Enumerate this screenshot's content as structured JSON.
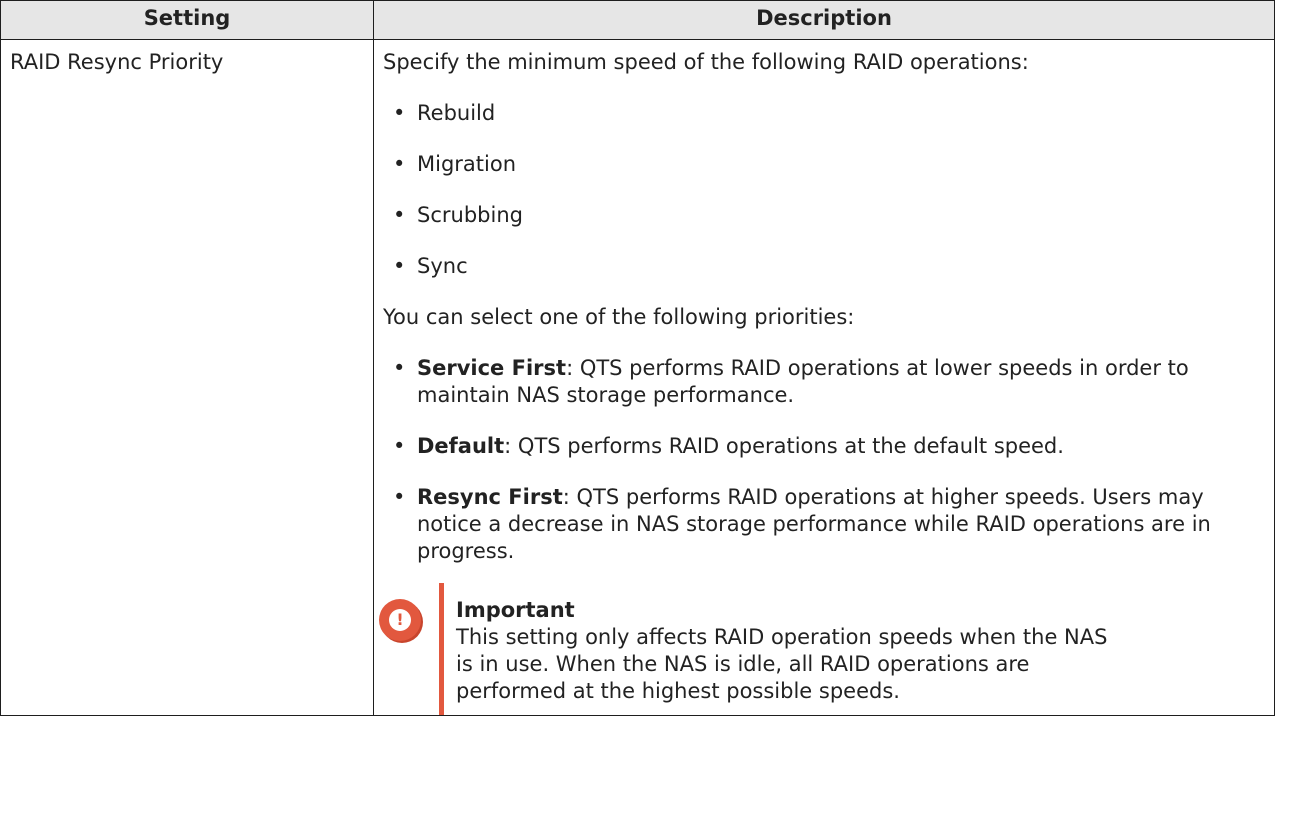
{
  "table": {
    "headers": {
      "setting": "Setting",
      "description": "Description"
    },
    "row": {
      "setting": "RAID Resync Priority",
      "intro": "Specify the minimum speed of the following RAID operations:",
      "operations": [
        "Rebuild",
        "Migration",
        "Scrubbing",
        "Sync"
      ],
      "priorities_intro": "You can select one of the following priorities:",
      "priorities": [
        {
          "term": "Service First",
          "text": ": QTS performs RAID operations at lower speeds in order to maintain NAS storage performance."
        },
        {
          "term": "Default",
          "text": ": QTS performs RAID operations at the default speed."
        },
        {
          "term": "Resync First",
          "text": ": QTS performs RAID operations at higher speeds. Users may notice a decrease in NAS storage performance while RAID operations are in progress."
        }
      ],
      "important": {
        "icon": "important-exclamation-icon",
        "glyph": "!",
        "title": "Important",
        "text": "This setting only affects RAID operation speeds when the NAS is in use. When the NAS is idle, all RAID operations are performed at the highest possible speeds."
      }
    }
  },
  "colors": {
    "header_bg": "#e6e6e6",
    "border": "#1e1e1e",
    "accent": "#e2583e"
  }
}
